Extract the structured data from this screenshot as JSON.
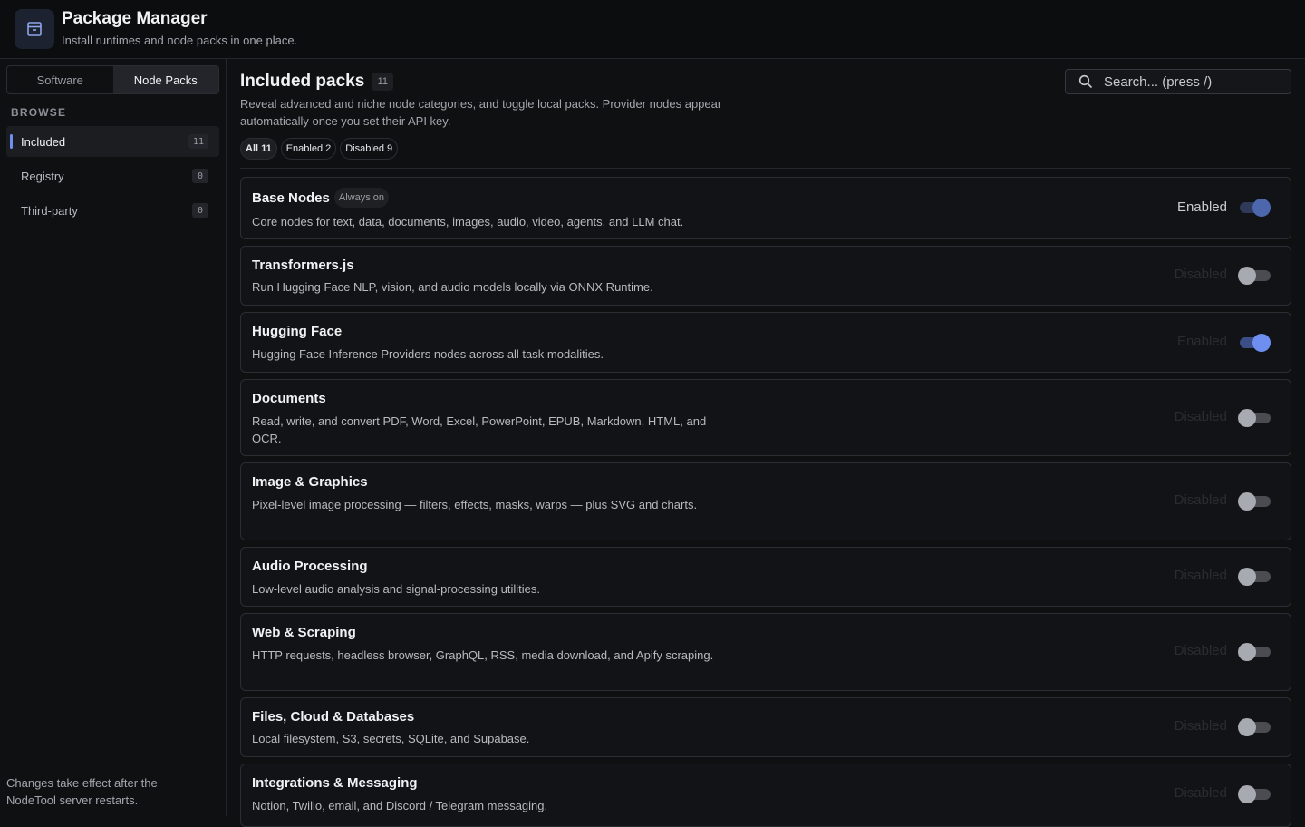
{
  "app": {
    "title": "Package Manager",
    "subtitle": "Install runtimes and node packs in one place.",
    "icon": "archive-box-icon"
  },
  "tabs": [
    {
      "label": "Software",
      "active": false
    },
    {
      "label": "Node Packs",
      "active": true
    }
  ],
  "sidebar": {
    "browse_label": "BROWSE",
    "items": [
      {
        "label": "Included",
        "count": "11",
        "active": true
      },
      {
        "label": "Registry",
        "count": "0",
        "active": false
      },
      {
        "label": "Third-party",
        "count": "0",
        "active": false
      }
    ],
    "footer": "Changes take effect after the NodeTool server restarts."
  },
  "main": {
    "title": "Included packs",
    "title_count": "11",
    "description": "Reveal advanced and niche node categories, and toggle local packs. Provider nodes appear automatically once you set their API key.",
    "filters": [
      {
        "label": "All",
        "count": "11",
        "active": true
      },
      {
        "label": "Enabled",
        "count": "2",
        "active": false
      },
      {
        "label": "Disabled",
        "count": "9",
        "active": false
      }
    ],
    "search_placeholder": "Search... (press /)"
  },
  "packs": [
    {
      "name": "Base Nodes",
      "badge": "Always on",
      "description": "Core nodes for text, data, documents, images, audio, video, agents, and LLM chat.",
      "status": "Enabled",
      "enabled": true
    },
    {
      "name": "Transformers.js",
      "description": "Run Hugging Face NLP, vision, and audio models locally via ONNX Runtime.",
      "status": "Disabled",
      "enabled": false
    },
    {
      "name": "Hugging Face",
      "description": "Hugging Face Inference Providers nodes across all task modalities.",
      "status": "Enabled",
      "enabled": true
    },
    {
      "name": "Documents",
      "description": "Read, write, and convert PDF, Word, Excel, PowerPoint, EPUB, Markdown, HTML, and OCR.",
      "status": "Disabled",
      "enabled": false
    },
    {
      "name": "Image & Graphics",
      "description": "Pixel-level image processing — filters, effects, masks, warps — plus SVG and charts.",
      "status": "Disabled",
      "enabled": false
    },
    {
      "name": "Audio Processing",
      "description": "Low-level audio analysis and signal-processing utilities.",
      "status": "Disabled",
      "enabled": false
    },
    {
      "name": "Web & Scraping",
      "description": "HTTP requests, headless browser, GraphQL, RSS, media download, and Apify scraping.",
      "status": "Disabled",
      "enabled": false
    },
    {
      "name": "Files, Cloud & Databases",
      "description": "Local filesystem, S3, secrets, SQLite, and Supabase.",
      "status": "Disabled",
      "enabled": false
    },
    {
      "name": "Integrations & Messaging",
      "description": "Notion, Twilio, email, and Discord / Telegram messaging.",
      "status": "Disabled",
      "enabled": false
    }
  ]
}
